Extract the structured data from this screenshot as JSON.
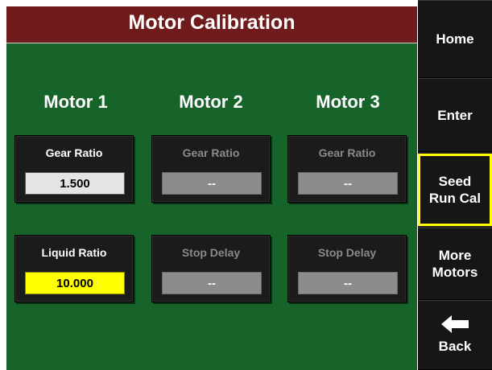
{
  "title": "Motor Calibration",
  "colors": {
    "title_bar": "#6f1b1b",
    "panel": "#16642a",
    "sidebar": "#161616",
    "highlight_border": "#ffff00",
    "value_active": "#e4e4e4",
    "value_selected": "#ffff00",
    "value_disabled": "#8c8c8c"
  },
  "motors": [
    {
      "heading": "Motor 1",
      "tiles": [
        {
          "label": "Gear Ratio",
          "value": "1.500",
          "state": "active"
        },
        {
          "label": "Liquid Ratio",
          "value": "10.000",
          "state": "selected"
        }
      ]
    },
    {
      "heading": "Motor 2",
      "tiles": [
        {
          "label": "Gear Ratio",
          "value": "--",
          "state": "disabled"
        },
        {
          "label": "Stop Delay",
          "value": "--",
          "state": "disabled"
        }
      ]
    },
    {
      "heading": "Motor 3",
      "tiles": [
        {
          "label": "Gear Ratio",
          "value": "--",
          "state": "disabled"
        },
        {
          "label": "Stop Delay",
          "value": "--",
          "state": "disabled"
        }
      ]
    }
  ],
  "sidebar": {
    "home": "Home",
    "enter": "Enter",
    "seed_run_cal": [
      "Seed",
      "Run Cal"
    ],
    "more_motors": [
      "More",
      "Motors"
    ],
    "back": "Back",
    "back_icon": "left-arrow-icon"
  }
}
